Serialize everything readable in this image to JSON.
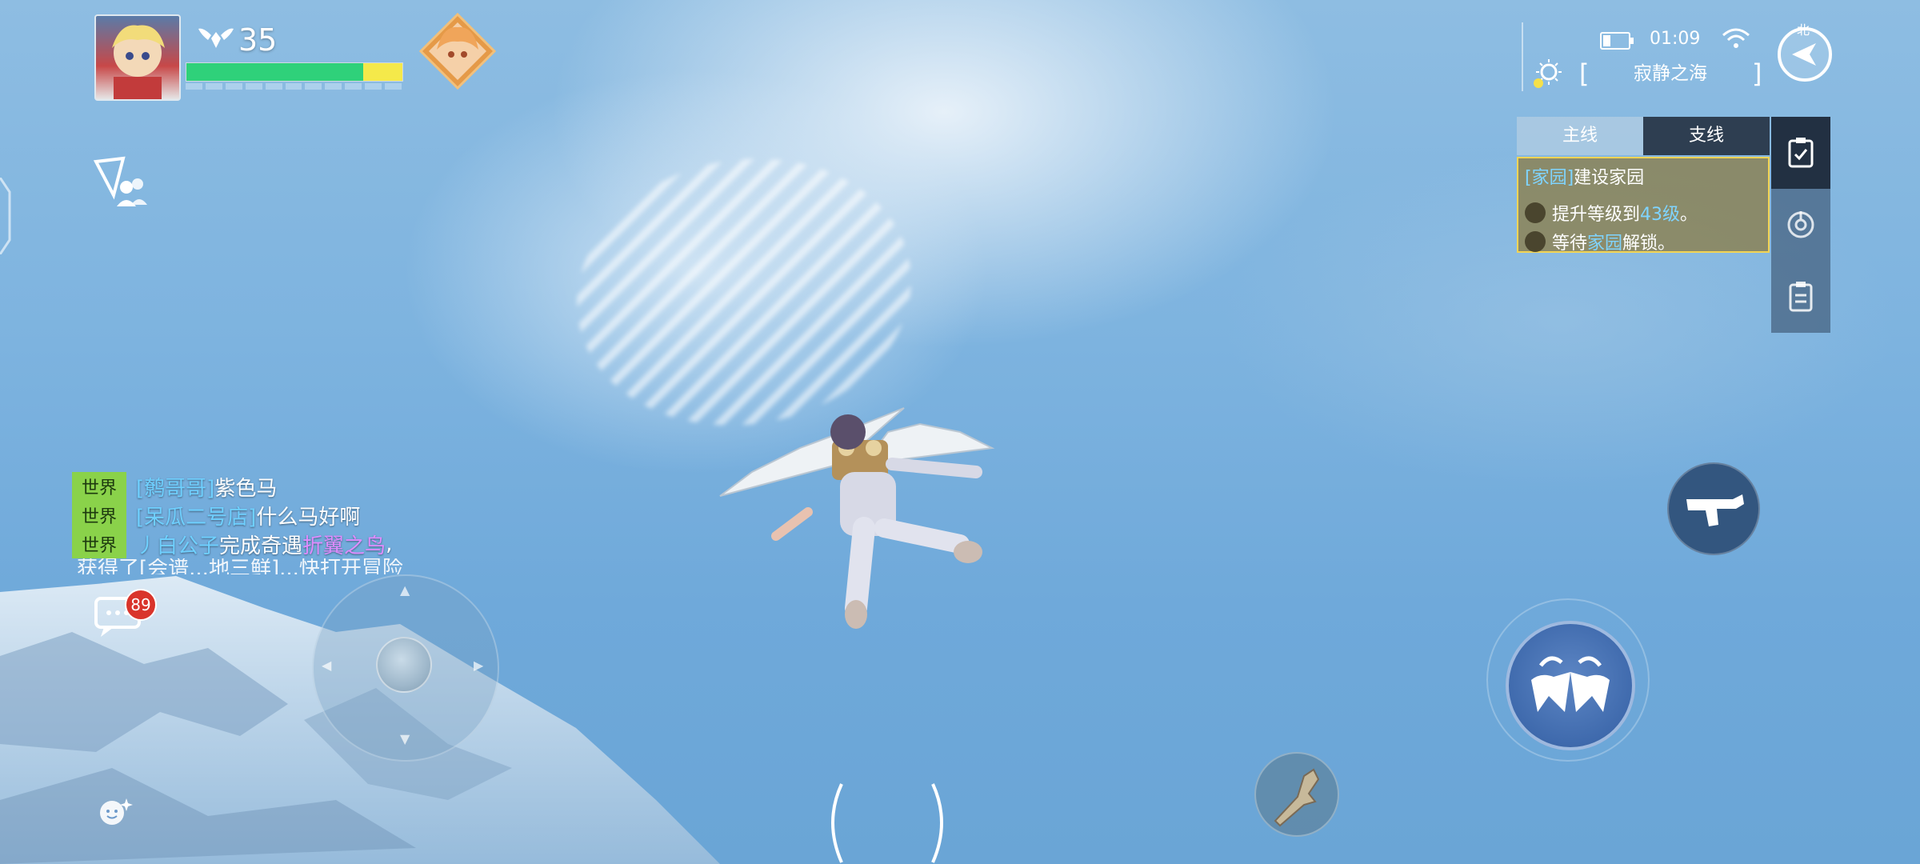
{
  "player": {
    "level": "35",
    "hp_fraction_green": 0.82,
    "hp_fraction_yellow": 0.18
  },
  "status": {
    "time": "01:09",
    "location": "寂静之海",
    "compass_north": "北",
    "battery_level": 0.3
  },
  "quest": {
    "tabs": [
      "主线",
      "支线"
    ],
    "title_bracket": "[家园]",
    "title_text": "建设家园",
    "objectives": [
      {
        "prefix": "提升等级到",
        "highlight": "43级",
        "suffix": "。"
      },
      {
        "prefix": "等待",
        "highlight": "家园",
        "suffix": "解锁。"
      }
    ]
  },
  "chat": {
    "lines": [
      {
        "channel": "世界",
        "name": "[鹩哥哥]",
        "text": "紫色马"
      },
      {
        "channel": "世界",
        "name": "[呆瓜二号店]",
        "text": "什么马好啊"
      },
      {
        "channel": "世界",
        "name": "丿白公子",
        "text": "完成奇遇",
        "highlight": "折翼之鸟",
        "tail": ","
      }
    ],
    "cut_line": "获得了[会谱...地三鲜]...快打开冒险",
    "unread_count": "89"
  },
  "colors": {
    "hp_green": "#2fd17a",
    "hp_yellow": "#f5e94a",
    "quest_border": "#f2d455",
    "highlight_blue": "#7fd4ff",
    "chat_tag": "#8ad24a",
    "badge_red": "#d9342b"
  },
  "icons": [
    "avatar",
    "rank-wings-icon",
    "pet-avatar",
    "guild-icon",
    "chat-icon",
    "emoji-icon",
    "battery-icon",
    "wifi-icon",
    "compass-icon",
    "weather-icon",
    "task-check-icon",
    "locate-icon",
    "clipboard-icon",
    "gun-icon",
    "wings-glide-icon",
    "item-icon"
  ]
}
